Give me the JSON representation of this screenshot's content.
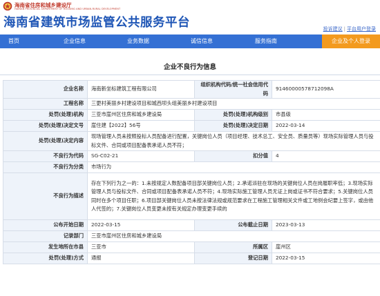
{
  "header": {
    "dept_cn": "海南省住房和城乡建设厅",
    "dept_en": "HAINAN PROVINCIAL DEPARTMENT OF HOUSING AND URBAN-RURAL DEVELOPMENT",
    "site_title": "海南省建筑市场监管公共服务平台",
    "links": [
      "投诉建议",
      "平台用户登录"
    ],
    "links_sep": "|",
    "emblem_icon": "emblem-icon"
  },
  "nav": {
    "items": [
      "首页",
      "企业信息",
      "业务数据",
      "诚信信息",
      "服务指南"
    ],
    "action": "企业及个人登录"
  },
  "colors": {
    "nav_bg": "#3470d4",
    "action_bg": "#f39a1e",
    "title": "#1f56b6",
    "dept": "#c0392b",
    "label_bg": "#eef3fa"
  },
  "page": {
    "title": "企业不良行为信息"
  },
  "record": {
    "company_label": "企业名称",
    "company": "海南新坐标建筑工程有限公司",
    "credit_code_label": "组织机构代码/统一社会信用代码",
    "credit_code": "91460000578712098A",
    "project_label": "工程名称",
    "project": "三更村美丽乡村建设项目和城西坝头组美丽乡村建设项目",
    "penalty_org_label": "处罚(处理)机构",
    "penalty_org": "三亚市崖州区住房和城乡建设局",
    "penalty_level_label": "处罚(处理)机构级别",
    "penalty_level": "市县级",
    "decision_no_label": "处罚(处理)决定文号",
    "decision_no": "崖住建【2022】56号",
    "decision_date_label": "处罚(处理)决定日期",
    "decision_date": "2022-03-14",
    "decision_content_label": "处罚(处理)决定内容",
    "decision_content": "现场管理人员未按照投标人员配备进行配置，关键岗位人员（项目经理、技术总工、安全员、质量员等）现场实际管理人员与投标文件、合同或项目配备表承诺人员不符；",
    "behavior_code_label": "不良行为代码",
    "behavior_code": "SG-C02-21",
    "score_label": "扣分值",
    "score": "4",
    "category_label": "不良行为分类",
    "category": "市场行为",
    "description_label": "不良行为描述",
    "description": "存在下列行为之一的：1.未按规定人数配备项目部关键岗位人员；2.承诺派驻在现场的关键岗位人员在岗履职率低；3.现场实际管理人员与投标文件、合同或项目配备表承诺人员不符；4.现场实际施工管理人员无证上岗或证书不符合要求；5.关键岗位人员同时在多个项目任职；6.项目部关键岗位人员未按法律法规或规范要求在工程施工管理相关文件或工地例会纪要上签字，或由他人代签的；7.关键岗位人员变更未按有关规定办理变更手续的",
    "publish_date_label": "公布开始日期",
    "publish_date": "2022-03-15",
    "publish_end_label": "公布截止日期",
    "publish_end": "2023-03-13",
    "record_org_label": "记录部门",
    "record_org": "三亚市崖州区住房和城乡建设局",
    "location_label": "发生地所在市县",
    "location": "三亚市",
    "district_label": "所属区",
    "district": "崖州区",
    "method_label": "处罚(处理)方式",
    "method": "通报",
    "register_date_label": "登记日期",
    "register_date": "2022-03-15"
  }
}
